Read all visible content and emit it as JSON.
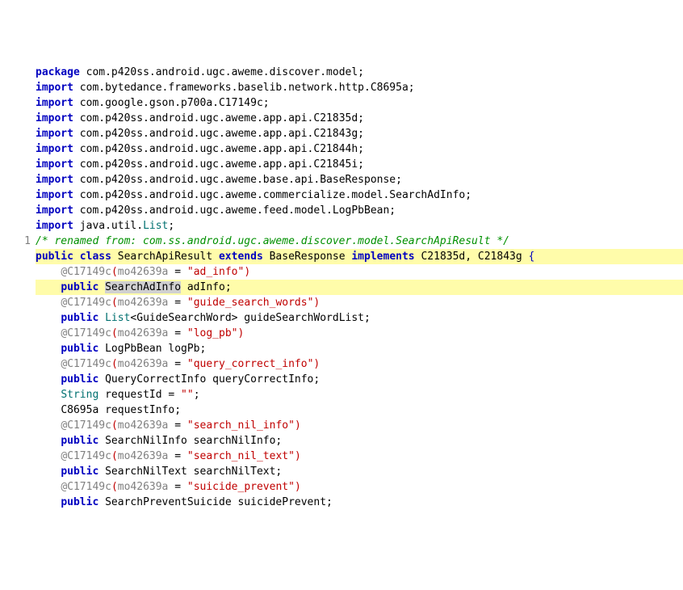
{
  "chart_data": {
    "type": "code",
    "language": "java",
    "highlighted_line_index": 14,
    "gutter_marker": {
      "text": "1",
      "line_index": 13
    },
    "lines": [
      {
        "tokens": [
          [
            "kw",
            "package"
          ],
          [
            "",
            " com.p420ss.android.ugc.aweme.discover.model;"
          ]
        ]
      },
      {
        "tokens": []
      },
      {
        "tokens": [
          [
            "kw",
            "import"
          ],
          [
            "",
            " com.bytedance.frameworks.baselib.network.http.C8695a;"
          ]
        ]
      },
      {
        "tokens": [
          [
            "kw",
            "import"
          ],
          [
            "",
            " com.google.gson.p700a.C17149c;"
          ]
        ]
      },
      {
        "tokens": [
          [
            "kw",
            "import"
          ],
          [
            "",
            " com.p420ss.android.ugc.aweme.app.api.C21835d;"
          ]
        ]
      },
      {
        "tokens": [
          [
            "kw",
            "import"
          ],
          [
            "",
            " com.p420ss.android.ugc.aweme.app.api.C21843g;"
          ]
        ]
      },
      {
        "tokens": [
          [
            "kw",
            "import"
          ],
          [
            "",
            " com.p420ss.android.ugc.aweme.app.api.C21844h;"
          ]
        ]
      },
      {
        "tokens": [
          [
            "kw",
            "import"
          ],
          [
            "",
            " com.p420ss.android.ugc.aweme.app.api.C21845i;"
          ]
        ]
      },
      {
        "tokens": [
          [
            "kw",
            "import"
          ],
          [
            "",
            " com.p420ss.android.ugc.aweme.base.api.BaseResponse;"
          ]
        ]
      },
      {
        "tokens": [
          [
            "kw",
            "import"
          ],
          [
            "",
            " com.p420ss.android.ugc.aweme.commercialize.model.SearchAdInfo;"
          ]
        ]
      },
      {
        "tokens": [
          [
            "kw",
            "import"
          ],
          [
            "",
            " com.p420ss.android.ugc.aweme.feed.model.LogPbBean;"
          ]
        ]
      },
      {
        "tokens": [
          [
            "kw",
            "import"
          ],
          [
            "",
            " java.util."
          ],
          [
            "type",
            "List"
          ],
          [
            "",
            ";"
          ]
        ]
      },
      {
        "tokens": []
      },
      {
        "tokens": [
          [
            "comment",
            "/* renamed from: com.ss.android.ugc.aweme.discover.model.SearchApiResult */"
          ]
        ]
      },
      {
        "tokens": [
          [
            "kw",
            "public class"
          ],
          [
            "",
            " SearchApiResult "
          ],
          [
            "kw",
            "extends"
          ],
          [
            "",
            " BaseResponse "
          ],
          [
            "kw",
            "implements"
          ],
          [
            "",
            " C21835d, C21843g "
          ],
          [
            "paren-blue",
            "{"
          ]
        ]
      },
      {
        "indent": 1,
        "tokens": [
          [
            "anno",
            "@C17149c"
          ],
          [
            "paren-red",
            "("
          ],
          [
            "num-anno",
            "mo42639a"
          ],
          [
            "",
            " = "
          ],
          [
            "str",
            "\"ad_info\""
          ],
          [
            "paren-red",
            ")"
          ]
        ]
      },
      {
        "indent": 1,
        "highlight": true,
        "tokens": [
          [
            "kw",
            "public"
          ],
          [
            "",
            " "
          ],
          [
            "hl-word",
            "SearchAdInfo"
          ],
          [
            "",
            " adInfo;"
          ]
        ]
      },
      {
        "indent": 1,
        "tokens": [
          [
            "anno",
            "@C17149c"
          ],
          [
            "paren-red",
            "("
          ],
          [
            "num-anno",
            "mo42639a"
          ],
          [
            "",
            " = "
          ],
          [
            "str",
            "\"guide_search_words\""
          ],
          [
            "paren-red",
            ")"
          ]
        ]
      },
      {
        "indent": 1,
        "tokens": [
          [
            "kw",
            "public"
          ],
          [
            "",
            " "
          ],
          [
            "type",
            "List"
          ],
          [
            "",
            "<GuideSearchWord> guideSearchWordList;"
          ]
        ]
      },
      {
        "indent": 1,
        "tokens": [
          [
            "anno",
            "@C17149c"
          ],
          [
            "paren-red",
            "("
          ],
          [
            "num-anno",
            "mo42639a"
          ],
          [
            "",
            " = "
          ],
          [
            "str",
            "\"log_pb\""
          ],
          [
            "paren-red",
            ")"
          ]
        ]
      },
      {
        "indent": 1,
        "tokens": [
          [
            "kw",
            "public"
          ],
          [
            "",
            " LogPbBean logPb;"
          ]
        ]
      },
      {
        "indent": 1,
        "tokens": [
          [
            "anno",
            "@C17149c"
          ],
          [
            "paren-red",
            "("
          ],
          [
            "num-anno",
            "mo42639a"
          ],
          [
            "",
            " = "
          ],
          [
            "str",
            "\"query_correct_info\""
          ],
          [
            "paren-red",
            ")"
          ]
        ]
      },
      {
        "indent": 1,
        "tokens": [
          [
            "kw",
            "public"
          ],
          [
            "",
            " QueryCorrectInfo queryCorrectInfo;"
          ]
        ]
      },
      {
        "indent": 1,
        "tokens": [
          [
            "type",
            "String"
          ],
          [
            "",
            " requestId = "
          ],
          [
            "str",
            "\"\""
          ],
          [
            "",
            ";"
          ]
        ]
      },
      {
        "indent": 1,
        "tokens": [
          [
            "",
            "C8695a requestInfo;"
          ]
        ]
      },
      {
        "indent": 1,
        "tokens": [
          [
            "anno",
            "@C17149c"
          ],
          [
            "paren-red",
            "("
          ],
          [
            "num-anno",
            "mo42639a"
          ],
          [
            "",
            " = "
          ],
          [
            "str",
            "\"search_nil_info\""
          ],
          [
            "paren-red",
            ")"
          ]
        ]
      },
      {
        "indent": 1,
        "tokens": [
          [
            "kw",
            "public"
          ],
          [
            "",
            " SearchNilInfo searchNilInfo;"
          ]
        ]
      },
      {
        "indent": 1,
        "tokens": [
          [
            "anno",
            "@C17149c"
          ],
          [
            "paren-red",
            "("
          ],
          [
            "num-anno",
            "mo42639a"
          ],
          [
            "",
            " = "
          ],
          [
            "str",
            "\"search_nil_text\""
          ],
          [
            "paren-red",
            ")"
          ]
        ]
      },
      {
        "indent": 1,
        "tokens": [
          [
            "kw",
            "public"
          ],
          [
            "",
            " SearchNilText searchNilText;"
          ]
        ]
      },
      {
        "indent": 1,
        "tokens": [
          [
            "anno",
            "@C17149c"
          ],
          [
            "paren-red",
            "("
          ],
          [
            "num-anno",
            "mo42639a"
          ],
          [
            "",
            " = "
          ],
          [
            "str",
            "\"suicide_prevent\""
          ],
          [
            "paren-red",
            ")"
          ]
        ]
      },
      {
        "indent": 1,
        "tokens": [
          [
            "kw",
            "public"
          ],
          [
            "",
            " SearchPreventSuicide suicidePrevent;"
          ]
        ]
      }
    ]
  }
}
